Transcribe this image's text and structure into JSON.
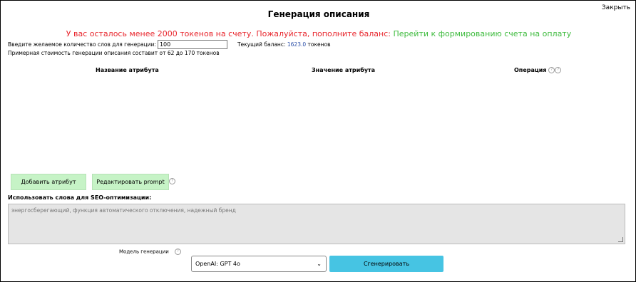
{
  "header": {
    "title": "Генерация описания",
    "close_label": "Закрыть"
  },
  "warning": {
    "text": "У вас осталось менее 2000 токенов на счету. Пожалуйста, пополните баланс: ",
    "link": "Перейти к формированию счета на оплату"
  },
  "words": {
    "label": "Введите желаемое количество слов для генерации:",
    "value": "100",
    "balance_label": "Текущий баланс:",
    "balance_value": "1623.0",
    "balance_unit": "токенов"
  },
  "cost_text": "Примерная стоимость генерации описания составит от 62 до 170 токенов",
  "table": {
    "col_name": "Название атрибута",
    "col_value": "Значение атрибута",
    "col_operation": "Операция",
    "help_icon": "question-circle-icon"
  },
  "buttons": {
    "add_attribute": "Добавить атрибут",
    "edit_prompt": "Редактировать prompt",
    "generate": "Сгенерировать"
  },
  "seo": {
    "label": "Использовать слова для SEO-оптимизации:",
    "placeholder": "энергосберегающий, функция автоматического отключения, надежный бренд"
  },
  "model": {
    "label": "Модель генерации",
    "selected": "OpenAI: GPT 4o"
  },
  "colors": {
    "warning_red": "#e8262d",
    "link_green": "#3dbb3d",
    "balance_blue": "#2b4fa8",
    "button_green": "#c6f3c6",
    "button_blue": "#46c4e3"
  }
}
